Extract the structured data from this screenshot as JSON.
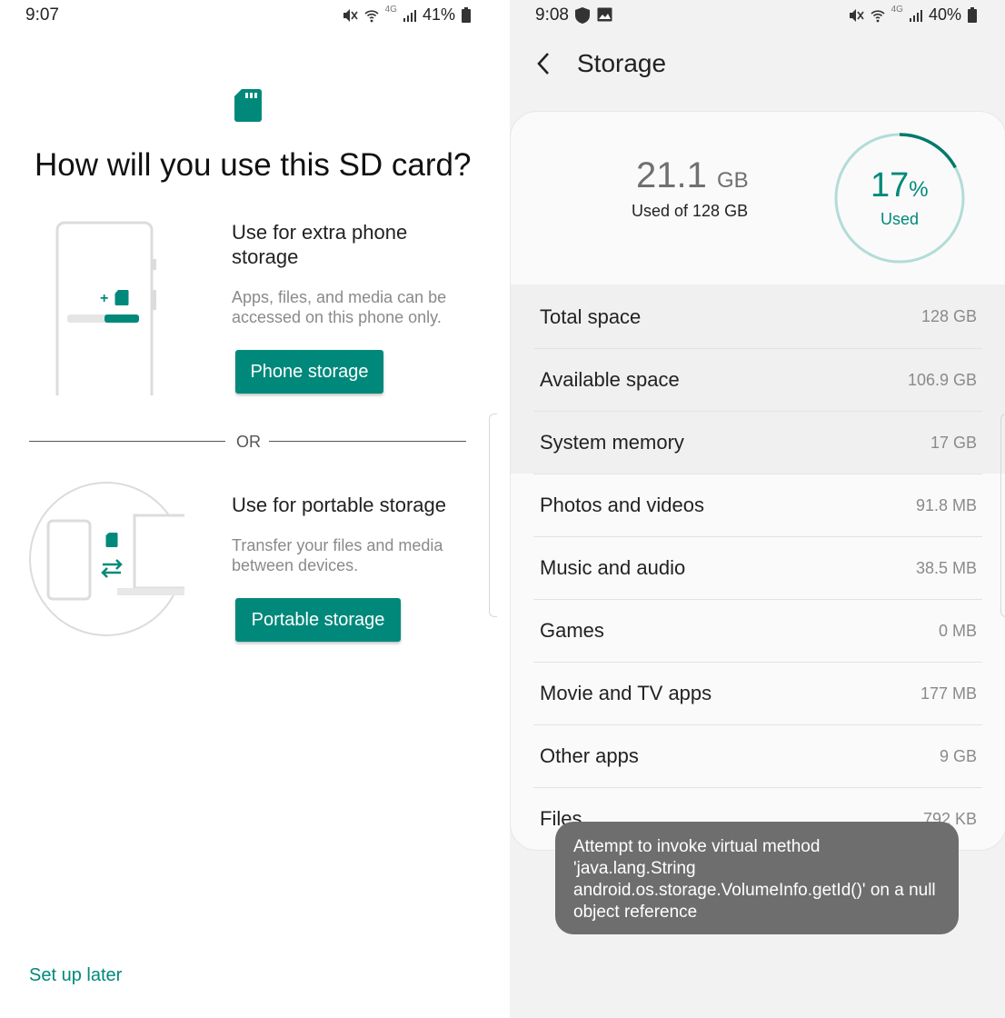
{
  "left": {
    "status": {
      "time": "9:07",
      "battery": "41%",
      "network": "4G"
    },
    "title": "How will you use this SD card?",
    "option1": {
      "title": "Use for extra phone storage",
      "description": "Apps, files, and media can be accessed on this phone only.",
      "button": "Phone storage"
    },
    "divider": "OR",
    "option2": {
      "title": "Use for portable storage",
      "description": "Transfer your files and media between devices.",
      "button": "Portable storage"
    },
    "setup_later": "Set up later",
    "colors": {
      "accent": "#00897b"
    }
  },
  "right": {
    "status": {
      "time": "9:08",
      "battery": "40%",
      "network": "4G"
    },
    "header": {
      "title": "Storage"
    },
    "summary": {
      "used_value": "21.1",
      "used_unit": "GB",
      "used_of": "Used of 128 GB",
      "percent": "17",
      "percent_unit": "%",
      "percent_label": "Used",
      "percent_fraction": 0.17
    },
    "rows": [
      {
        "label": "Total space",
        "value": "128 GB"
      },
      {
        "label": "Available space",
        "value": "106.9 GB"
      },
      {
        "label": "System memory",
        "value": "17 GB"
      },
      {
        "label": "Photos and videos",
        "value": "91.8 MB"
      },
      {
        "label": "Music and audio",
        "value": "38.5 MB"
      },
      {
        "label": "Games",
        "value": "0 MB"
      },
      {
        "label": "Movie and TV apps",
        "value": "177 MB"
      },
      {
        "label": "Other apps",
        "value": "9 GB"
      },
      {
        "label": "Files",
        "value": "792 KB"
      }
    ],
    "toast": "Attempt to invoke virtual method 'java.lang.String android.os.storage.VolumeInfo.getId()' on a null object reference"
  }
}
